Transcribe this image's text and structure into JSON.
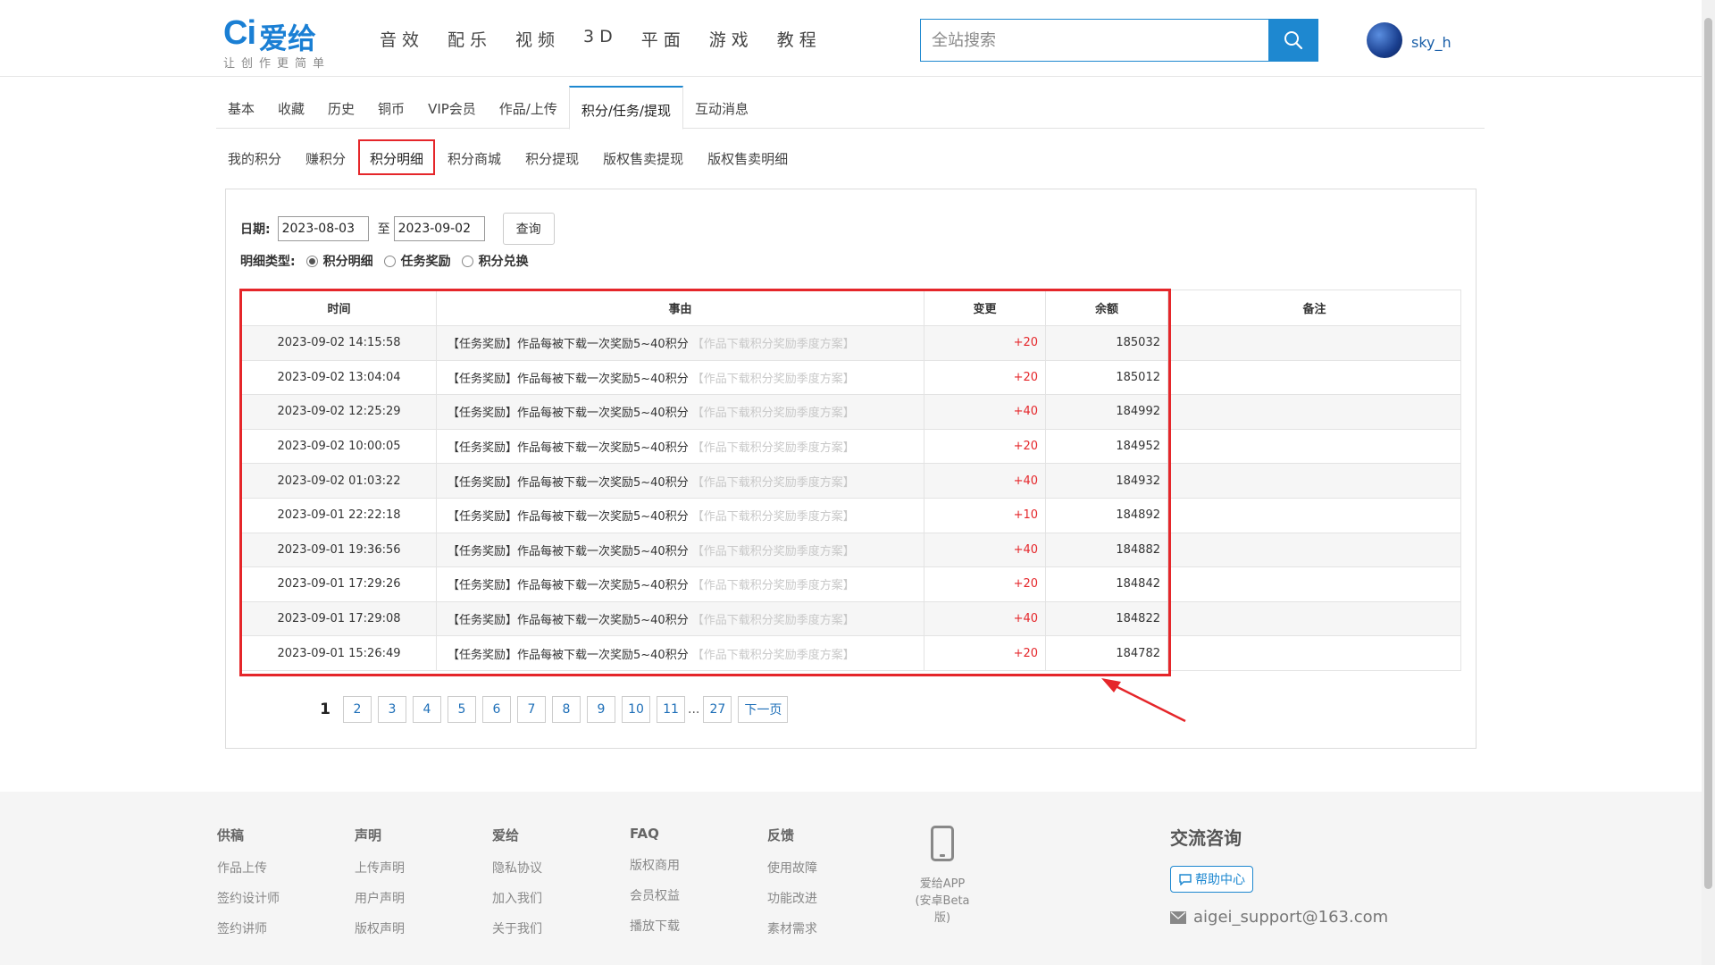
{
  "header": {
    "logo_mark": "Ci",
    "logo_name": "爱给",
    "slogan": "让创作更简单",
    "nav": [
      "音效",
      "配乐",
      "视频",
      "3D",
      "平面",
      "游戏",
      "教程"
    ],
    "search_placeholder": "全站搜索",
    "username": "sky_h"
  },
  "tabs_main": [
    "基本",
    "收藏",
    "历史",
    "铜币",
    "VIP会员",
    "作品/上传",
    "积分/任务/提现",
    "互动消息"
  ],
  "tabs_main_active": "积分/任务/提现",
  "tabs_sub": [
    "我的积分",
    "赚积分",
    "积分明细",
    "积分商城",
    "积分提现",
    "版权售卖提现",
    "版权售卖明细"
  ],
  "tabs_sub_active": "积分明细",
  "filter": {
    "date_label": "日期:",
    "date_from": "2023-08-03",
    "date_sep": "至",
    "date_to": "2023-09-02",
    "query_label": "查询",
    "type_label": "明细类型:",
    "types": [
      "积分明细",
      "任务奖励",
      "积分兑换"
    ],
    "type_selected": "积分明细"
  },
  "table": {
    "headers": [
      "时间",
      "事由",
      "变更",
      "余额",
      "备注"
    ],
    "rows": [
      {
        "time": "2023-09-02 14:15:58",
        "reason": "【任务奖励】作品每被下载一次奖励5~40积分",
        "link": "【作品下载积分奖励季度方案】",
        "change": "+20",
        "balance": "185032",
        "note": ""
      },
      {
        "time": "2023-09-02 13:04:04",
        "reason": "【任务奖励】作品每被下载一次奖励5~40积分",
        "link": "【作品下载积分奖励季度方案】",
        "change": "+20",
        "balance": "185012",
        "note": ""
      },
      {
        "time": "2023-09-02 12:25:29",
        "reason": "【任务奖励】作品每被下载一次奖励5~40积分",
        "link": "【作品下载积分奖励季度方案】",
        "change": "+40",
        "balance": "184992",
        "note": ""
      },
      {
        "time": "2023-09-02 10:00:05",
        "reason": "【任务奖励】作品每被下载一次奖励5~40积分",
        "link": "【作品下载积分奖励季度方案】",
        "change": "+20",
        "balance": "184952",
        "note": ""
      },
      {
        "time": "2023-09-02 01:03:22",
        "reason": "【任务奖励】作品每被下载一次奖励5~40积分",
        "link": "【作品下载积分奖励季度方案】",
        "change": "+40",
        "balance": "184932",
        "note": ""
      },
      {
        "time": "2023-09-01 22:22:18",
        "reason": "【任务奖励】作品每被下载一次奖励5~40积分",
        "link": "【作品下载积分奖励季度方案】",
        "change": "+10",
        "balance": "184892",
        "note": ""
      },
      {
        "time": "2023-09-01 19:36:56",
        "reason": "【任务奖励】作品每被下载一次奖励5~40积分",
        "link": "【作品下载积分奖励季度方案】",
        "change": "+40",
        "balance": "184882",
        "note": ""
      },
      {
        "time": "2023-09-01 17:29:26",
        "reason": "【任务奖励】作品每被下载一次奖励5~40积分",
        "link": "【作品下载积分奖励季度方案】",
        "change": "+20",
        "balance": "184842",
        "note": ""
      },
      {
        "time": "2023-09-01 17:29:08",
        "reason": "【任务奖励】作品每被下载一次奖励5~40积分",
        "link": "【作品下载积分奖励季度方案】",
        "change": "+40",
        "balance": "184822",
        "note": ""
      },
      {
        "time": "2023-09-01 15:26:49",
        "reason": "【任务奖励】作品每被下载一次奖励5~40积分",
        "link": "【作品下载积分奖励季度方案】",
        "change": "+20",
        "balance": "184782",
        "note": ""
      }
    ]
  },
  "pagination": {
    "current": "1",
    "pages": [
      "2",
      "3",
      "4",
      "5",
      "6",
      "7",
      "8",
      "9",
      "10",
      "11"
    ],
    "ellipsis": "...",
    "last": "27",
    "next": "下一页"
  },
  "footer": {
    "columns": [
      {
        "head": "供稿",
        "links": [
          "作品上传",
          "签约设计师",
          "签约讲师"
        ]
      },
      {
        "head": "声明",
        "links": [
          "上传声明",
          "用户声明",
          "版权声明"
        ]
      },
      {
        "head": "爱给",
        "links": [
          "隐私协议",
          "加入我们",
          "关于我们"
        ]
      },
      {
        "head": "FAQ",
        "links": [
          "版权商用",
          "会员权益",
          "播放下载"
        ]
      },
      {
        "head": "反馈",
        "links": [
          "使用故障",
          "功能改进",
          "素材需求"
        ]
      }
    ],
    "app_line1": "爱给APP",
    "app_line2": "(安卓Beta版)",
    "contact_title": "交流咨询",
    "help_label": "帮助中心",
    "email": "aigei_support@163.com"
  },
  "colors": {
    "accent": "#1e88d0",
    "highlight": "#e5262a",
    "change_text": "#e5262a"
  }
}
